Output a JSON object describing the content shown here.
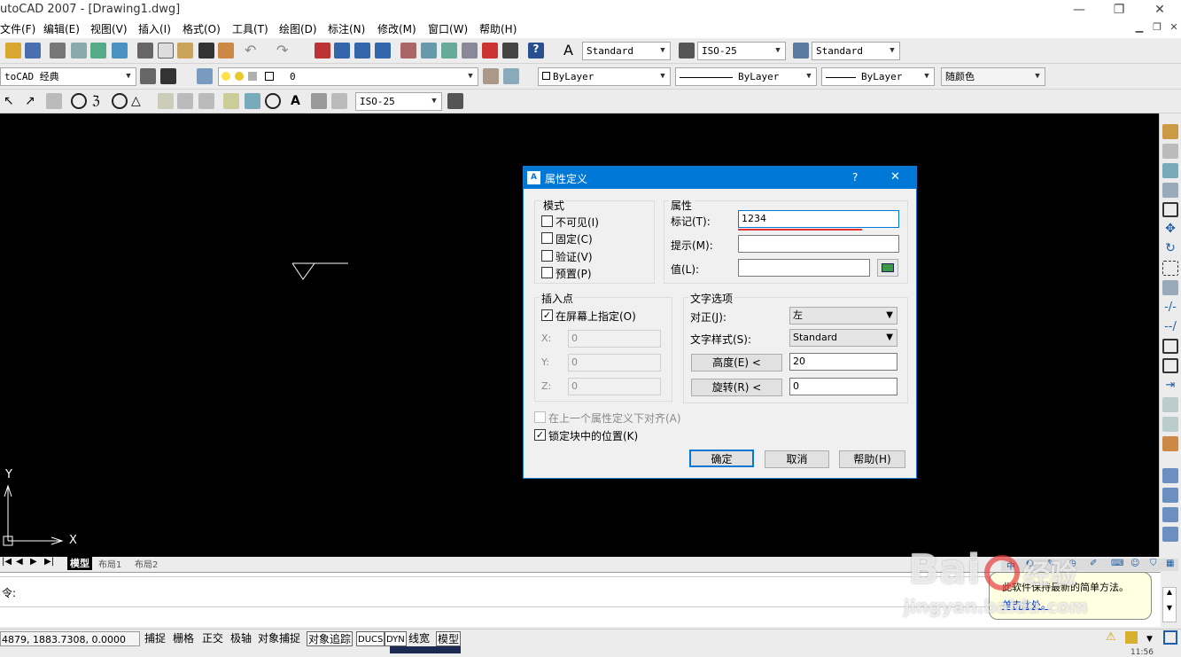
{
  "window": {
    "title": "utoCAD 2007 - [Drawing1.dwg]",
    "minimize": "—",
    "maximize": "❐",
    "close": "✕"
  },
  "menu": [
    "文件(F)",
    "编辑(E)",
    "视图(V)",
    "插入(I)",
    "格式(O)",
    "工具(T)",
    "绘图(D)",
    "标注(N)",
    "修改(M)",
    "窗口(W)",
    "帮助(H)"
  ],
  "toolbar1": {
    "text_style": "Standard",
    "dim_style": "ISO-25",
    "table_style": "Standard"
  },
  "toolbar2": {
    "workspace": "toCAD 经典",
    "layer": "0",
    "color": "ByLayer",
    "linetype": "ByLayer",
    "lineweight": "ByLayer",
    "plot_style": "随颜色"
  },
  "toolbar3": {
    "dim_style": "ISO-25"
  },
  "ucs": {
    "x": "X",
    "y": "Y"
  },
  "tabs": [
    "模型",
    "布局1",
    "布局2"
  ],
  "command": {
    "prompt": "令:"
  },
  "status": {
    "coords": "4879, 1883.7308, 0.0000",
    "toggles": [
      "捕捉",
      "栅格",
      "正交",
      "极轴",
      "对象捕捉",
      "对象追踪",
      "DUCS",
      "DYN",
      "线宽",
      "模型"
    ],
    "clock": "11:56"
  },
  "balloon": {
    "line1": "此软件保持最新的简单方法。",
    "link": "单击此处。"
  },
  "dialog": {
    "title": "属性定义",
    "help": "?",
    "close": "✕",
    "mode": {
      "label": "模式",
      "items": [
        {
          "label": "不可见(I)",
          "checked": false
        },
        {
          "label": "固定(C)",
          "checked": false
        },
        {
          "label": "验证(V)",
          "checked": false
        },
        {
          "label": "预置(P)",
          "checked": false
        }
      ]
    },
    "attribute": {
      "label": "属性",
      "tag_label": "标记(T):",
      "tag_value": "1234",
      "prompt_label": "提示(M):",
      "prompt_value": "",
      "value_label": "值(L):",
      "value_value": ""
    },
    "insert": {
      "label": "插入点",
      "on_screen": "在屏幕上指定(O)",
      "on_screen_checked": true,
      "x_label": "X:",
      "x": "0",
      "y_label": "Y:",
      "y": "0",
      "z_label": "Z:",
      "z": "0"
    },
    "text": {
      "label": "文字选项",
      "just_label": "对正(J):",
      "just": "左",
      "style_label": "文字样式(S):",
      "style": "Standard",
      "height_btn": "高度(E) <",
      "height": "20",
      "rot_btn": "旋转(R) <",
      "rot": "0"
    },
    "align_prev": "在上一个属性定义下对齐(A)",
    "lock": "锁定块中的位置(K)",
    "lock_checked": true,
    "ok": "确定",
    "cancel": "取消",
    "help_btn": "帮助(H)"
  },
  "watermark": {
    "brand": "Bai",
    "brand2": "经验",
    "url": "jingyan.baidu.com"
  },
  "colors": {
    "canvas": "#000000",
    "dialog_header": "#0078d7",
    "underline": "#e03030"
  }
}
